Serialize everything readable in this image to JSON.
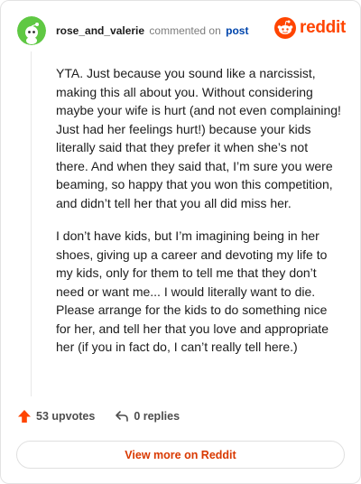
{
  "comment": {
    "username": "rose_and_valerie",
    "verb": "commented on",
    "post_link": "post",
    "paragraphs": [
      "YTA. Just because you sound like a narcissist, making this all about you. Without considering maybe your wife is hurt (and not even complaining! Just had her feelings hurt!) because your kids literally said that they prefer it when she’s not there. And when they said that, I’m sure you were beaming, so happy that you won this competition, and didn’t tell her that you all did miss her.",
      "I don’t have kids, but I’m imagining being in her shoes, giving up a career and devoting my life to my kids, only for them to tell me that they don’t need or want me... I would literally want to die. Please arrange for the kids to do something nice for her, and tell her that you love and appropriate her (if you in fact do, I can’t really tell here.)"
    ]
  },
  "brand": {
    "wordmark": "reddit",
    "color": "#ff4500"
  },
  "actions": {
    "upvotes": "53 upvotes",
    "replies": "0 replies"
  },
  "footer": {
    "view_more": "View more on Reddit"
  },
  "icons": {
    "avatar": "snoo-avatar-icon",
    "logo": "reddit-logo-icon",
    "upvote": "upvote-arrow-icon",
    "reply": "reply-arrow-icon"
  },
  "colors": {
    "accent": "#ff4500",
    "link": "#0045ac",
    "view_more": "#d93900",
    "avatar_bg": "#5fc843"
  }
}
